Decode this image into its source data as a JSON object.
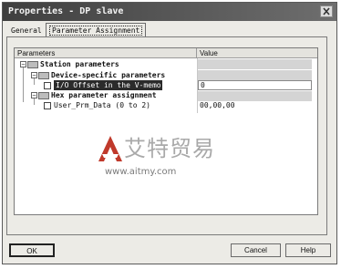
{
  "window": {
    "title": "Properties - DP slave"
  },
  "tabs": [
    {
      "label": "General",
      "active": false
    },
    {
      "label": "Parameter Assignment",
      "active": true
    }
  ],
  "grid": {
    "headers": {
      "parameters": "Parameters",
      "value": "Value"
    },
    "rows": [
      {
        "label": "Station parameters",
        "level": 0,
        "expanded": true,
        "bold": true,
        "value": ""
      },
      {
        "label": "Device-specific parameters",
        "level": 1,
        "expanded": true,
        "bold": true,
        "value": ""
      },
      {
        "label": "I/O Offset in the V-memory",
        "level": 2,
        "selected": true,
        "value": "0"
      },
      {
        "label": "Hex parameter assignment",
        "level": 1,
        "expanded": true,
        "bold": true,
        "value": ""
      },
      {
        "label": "User_Prm_Data (0 to 2)",
        "level": 2,
        "value": "00,00,00"
      }
    ]
  },
  "watermark": {
    "chinese_text": "艾特贸易",
    "url": "www.aitmy.com"
  },
  "buttons": {
    "ok": "OK",
    "cancel": "Cancel",
    "help": "Help"
  },
  "colors": {
    "titlebar": "#3f3f3f",
    "selection": "#2b2b2b",
    "watermark_red": "#c0392b"
  }
}
